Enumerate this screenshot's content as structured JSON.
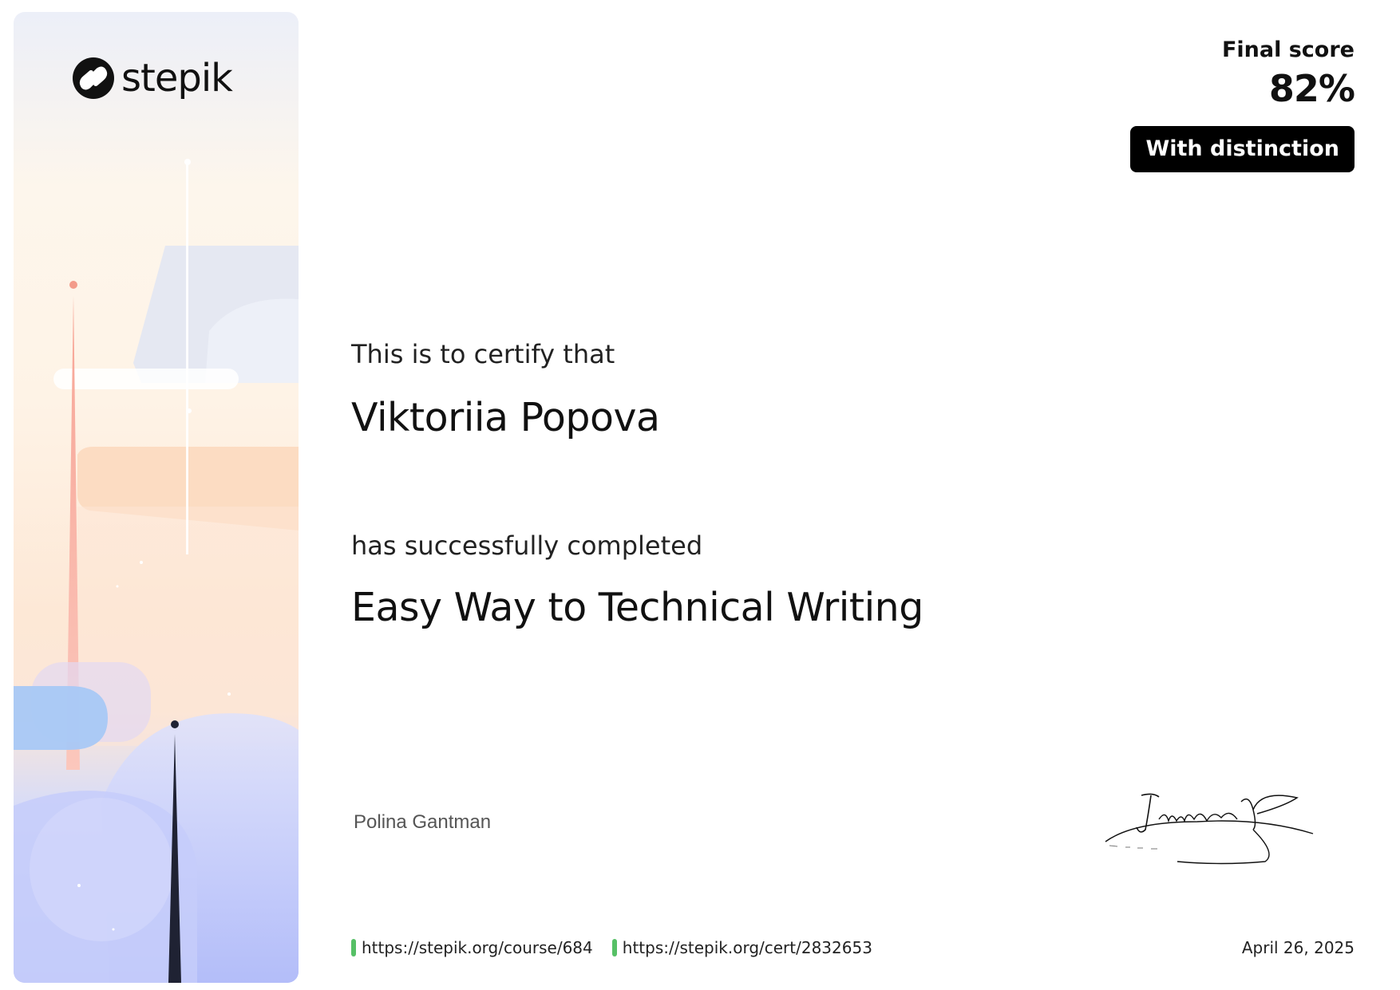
{
  "brand": {
    "name": "stepik",
    "logo_icon": "stepik-logo-icon"
  },
  "score": {
    "label": "Final score",
    "value": "82%",
    "badge": "With distinction"
  },
  "certificate": {
    "intro": "This is to certify that",
    "recipient": "Viktoriia Popova",
    "completed_intro": "has successfully completed",
    "course_title": "Easy Way to Technical Writing"
  },
  "signature": {
    "signer_name": "Polina Gantman",
    "image": "handwritten-signature"
  },
  "footer": {
    "course_link": "https://stepik.org/course/684",
    "cert_link": "https://stepik.org/cert/2832653",
    "date": "April 26, 2025",
    "link_marker_color": "#56c066"
  }
}
